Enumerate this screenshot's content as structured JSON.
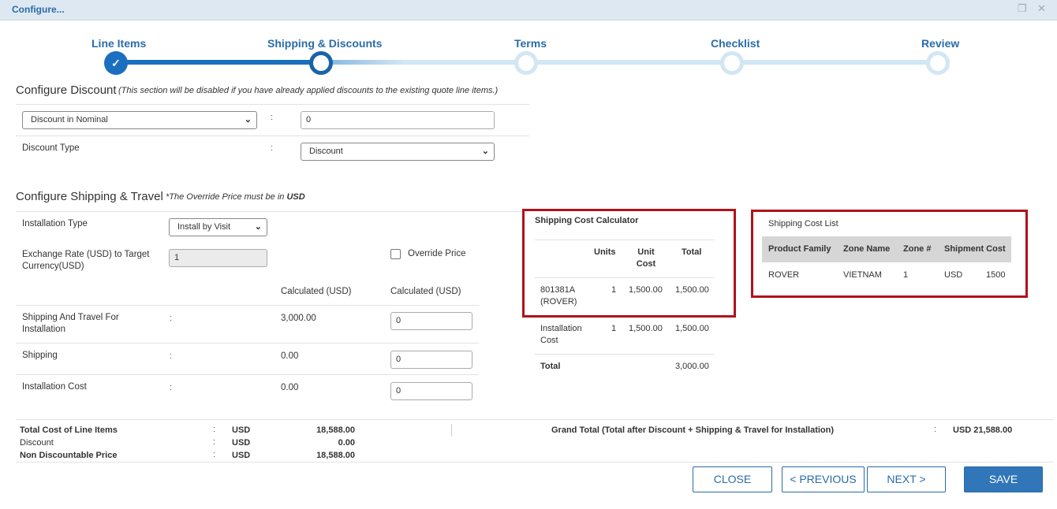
{
  "window": {
    "title": "Configure...",
    "restore_glyph": "❐",
    "close_glyph": "✕"
  },
  "steps": [
    {
      "label": "Line Items",
      "state": "done"
    },
    {
      "label": "Shipping & Discounts",
      "state": "active"
    },
    {
      "label": "Terms",
      "state": "todo"
    },
    {
      "label": "Checklist",
      "state": "todo"
    },
    {
      "label": "Review",
      "state": "todo"
    }
  ],
  "check_glyph": "✓",
  "discount": {
    "title": "Configure Discount",
    "note": "(This section will be disabled if you have already applied discounts to the existing quote line items.)",
    "mode_select": "Discount in Nominal",
    "value": "0",
    "type_label": "Discount Type",
    "type_select": "Discount"
  },
  "shipping": {
    "title": "Configure Shipping & Travel",
    "note_prefix": "*The Override Price must be in ",
    "note_currency": "USD",
    "installation_type_label": "Installation Type",
    "installation_type_select": "Install by Visit",
    "exchange_rate_label": "Exchange Rate (USD) to Target Currency(USD)",
    "exchange_rate_value": "1",
    "override_label": "Override Price",
    "col_calculated": "Calculated (USD)",
    "col_override": "Calculated (USD)",
    "rows": [
      {
        "label": "Shipping And Travel For Installation",
        "calculated": "3,000.00",
        "override": "0"
      },
      {
        "label": "Shipping",
        "calculated": "0.00",
        "override": "0"
      },
      {
        "label": "Installation Cost",
        "calculated": "0.00",
        "override": "0"
      }
    ]
  },
  "calculator": {
    "title": "Shipping Cost Calculator",
    "headers": {
      "units": "Units",
      "unit_cost": "Unit Cost",
      "total": "Total"
    },
    "rows": [
      {
        "name": "801381A (ROVER)",
        "units": "1",
        "unit_cost": "1,500.00",
        "total": "1,500.00"
      },
      {
        "name": "Installation Cost",
        "units": "1",
        "unit_cost": "1,500.00",
        "total": "1,500.00"
      }
    ],
    "total_label": "Total",
    "total_value": "3,000.00"
  },
  "cost_list": {
    "title": "Shipping Cost List",
    "headers": [
      "Product Family",
      "Zone Name",
      "Zone #",
      "Shipment Cost"
    ],
    "row": {
      "family": "ROVER",
      "zone": "VIETNAM",
      "zone_no": "1",
      "currency": "USD",
      "cost": "1500"
    }
  },
  "summary": {
    "lines": [
      {
        "label": "Total Cost of Line Items",
        "currency": "USD",
        "amount": "18,588.00"
      },
      {
        "label": "Discount",
        "currency": "USD",
        "amount": "0.00"
      },
      {
        "label": "Non Discountable Price",
        "currency": "USD",
        "amount": "18,588.00"
      }
    ],
    "grand_label": "Grand Total (Total after Discount + Shipping & Travel for Installation)",
    "grand_value": "USD 21,588.00"
  },
  "buttons": {
    "close": "CLOSE",
    "previous": "< PREVIOUS",
    "next": "NEXT >",
    "save": "SAVE"
  },
  "colors": {
    "accent": "#2a6ca8",
    "highlight_border": "#b0121b",
    "header_bg": "#d6d6d6"
  }
}
